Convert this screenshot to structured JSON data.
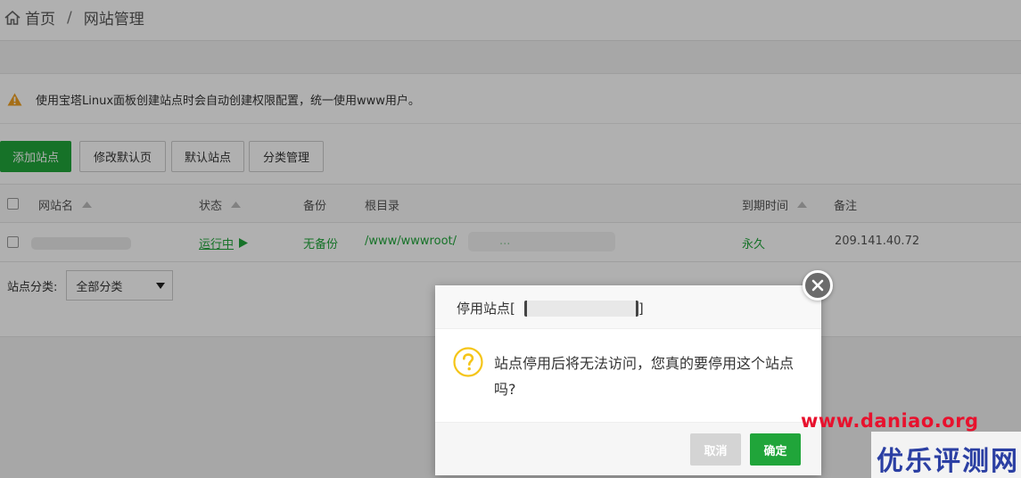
{
  "breadcrumb": {
    "home": "首页",
    "separator": "/",
    "current": "网站管理"
  },
  "notice": {
    "text": "使用宝塔Linux面板创建站点时会自动创建权限配置，统一使用www用户。",
    "icon": "warning-icon"
  },
  "toolbar": {
    "add_site": "添加站点",
    "edit_default_page": "修改默认页",
    "default_site": "默认站点",
    "category_manage": "分类管理"
  },
  "table": {
    "headers": {
      "site_name": "网站名",
      "status": "状态",
      "backup": "备份",
      "root_dir": "根目录",
      "expiry": "到期时间",
      "remark": "备注"
    },
    "rows": [
      {
        "site_name": "",
        "status": "运行中",
        "backup": "无备份",
        "root_dir": "/www/wwwroot/",
        "root_dir_tail": "...",
        "expiry": "永久",
        "remark": "209.141.40.72"
      }
    ]
  },
  "category_filter": {
    "label": "站点分类:",
    "selected": "全部分类"
  },
  "modal": {
    "title": "停用站点",
    "title_bracket_open": "[",
    "title_bracket_close": "]",
    "message": "站点停用后将无法访问，您真的要停用这个站点吗?",
    "cancel": "取消",
    "confirm": "确定"
  },
  "watermark": {
    "url": "www.daniao.org",
    "name": "优乐评测网"
  },
  "colors": {
    "accent": "#20a53a",
    "warning": "#f0a020",
    "question": "#f5c518",
    "watermark_url": "#e8112d",
    "watermark_name": "#2b3fa3"
  }
}
